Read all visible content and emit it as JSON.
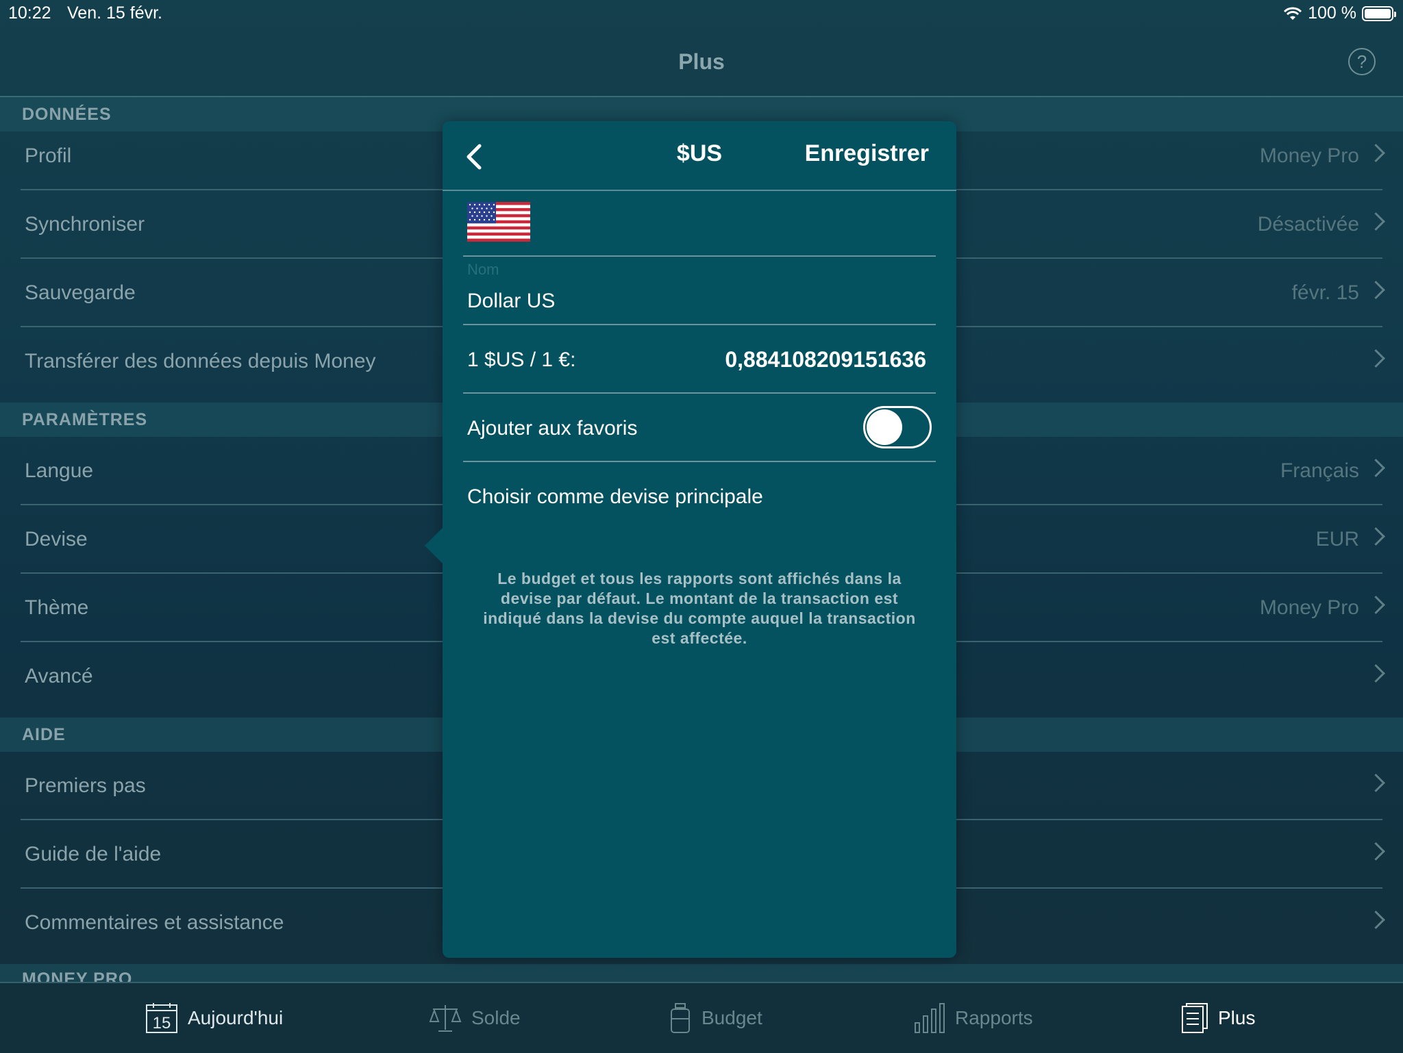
{
  "status": {
    "time": "10:22",
    "date": "Ven. 15 févr.",
    "battery": "100 %"
  },
  "nav": {
    "title": "Plus",
    "help": "?"
  },
  "sections": {
    "data": "DONNÉES",
    "settings": "PARAMÈTRES",
    "help": "AIDE",
    "moneypro": "MONEY PRO"
  },
  "rows": {
    "profil": {
      "label": "Profil",
      "value": "Money Pro"
    },
    "sync": {
      "label": "Synchroniser",
      "value": "Désactivée"
    },
    "backup": {
      "label": "Sauvegarde",
      "value": "févr. 15"
    },
    "transfer": {
      "label": "Transférer des données depuis Money"
    },
    "language": {
      "label": "Langue",
      "value": "Français"
    },
    "currency": {
      "label": "Devise",
      "value": "EUR"
    },
    "theme": {
      "label": "Thème",
      "value": "Money Pro"
    },
    "advanced": {
      "label": "Avancé"
    },
    "firststeps": {
      "label": "Premiers pas"
    },
    "guide": {
      "label": "Guide de l'aide"
    },
    "feedback": {
      "label": "Commentaires et assistance"
    }
  },
  "modal": {
    "title": "$US",
    "save": "Enregistrer",
    "flag_icon": "us-flag-icon",
    "name_label": "Nom",
    "name_value": "Dollar US",
    "rate_label": "1 $US / 1 €:",
    "rate_value": "0,884108209151636",
    "favorite_label": "Ajouter aux favoris",
    "favorite_on": false,
    "main_currency": "Choisir comme devise principale",
    "note": "Le budget et tous les rapports sont affichés dans la devise par défaut. Le montant de la transaction est indiqué dans la devise du compte auquel la transaction est affectée."
  },
  "tabs": {
    "today": "Aujourd'hui",
    "today_day": "15",
    "balance": "Solde",
    "budget": "Budget",
    "reports": "Rapports",
    "more": "Plus"
  },
  "colors": {
    "modal_bg": "#04525f",
    "accent": "#ffffff"
  }
}
